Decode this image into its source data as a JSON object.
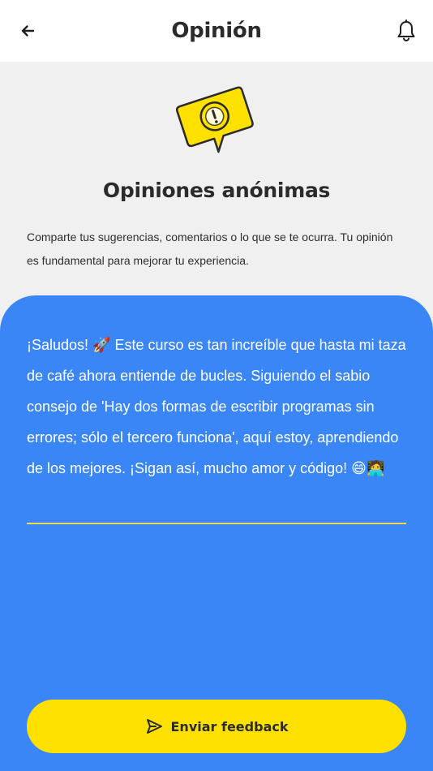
{
  "header": {
    "title": "Opinión",
    "back_icon": "arrow-left-icon",
    "notifications_icon": "bell-icon"
  },
  "hero": {
    "icon": "speech-bubble-exclamation-icon",
    "title": "Opiniones anónimas",
    "description": "Comparte tus sugerencias, comentarios o lo que se te ocurra. Tu opinión es fundamental para mejorar tu experiencia."
  },
  "feedback": {
    "value": "¡Saludos! 🚀 Este curso es tan increíble que hasta mi taza de café ahora entiende de bucles. Siguiendo el sabio consejo de 'Hay dos formas de escribir programas sin errores; sólo el tercero funciona', aquí estoy, aprendiendo de los mejores. ¡Sigan así, mucho amor y código! 😄🧑‍💻"
  },
  "submit": {
    "label": "Enviar feedback",
    "icon": "send-icon"
  },
  "colors": {
    "header_bg": "#ffffff",
    "page_bg": "#f0f0f0",
    "panel_bg": "#3a86f7",
    "accent_yellow": "#ffe100",
    "underline": "#f2d94e",
    "text_dark": "#2b2b2b",
    "text_light": "#ffffff"
  }
}
